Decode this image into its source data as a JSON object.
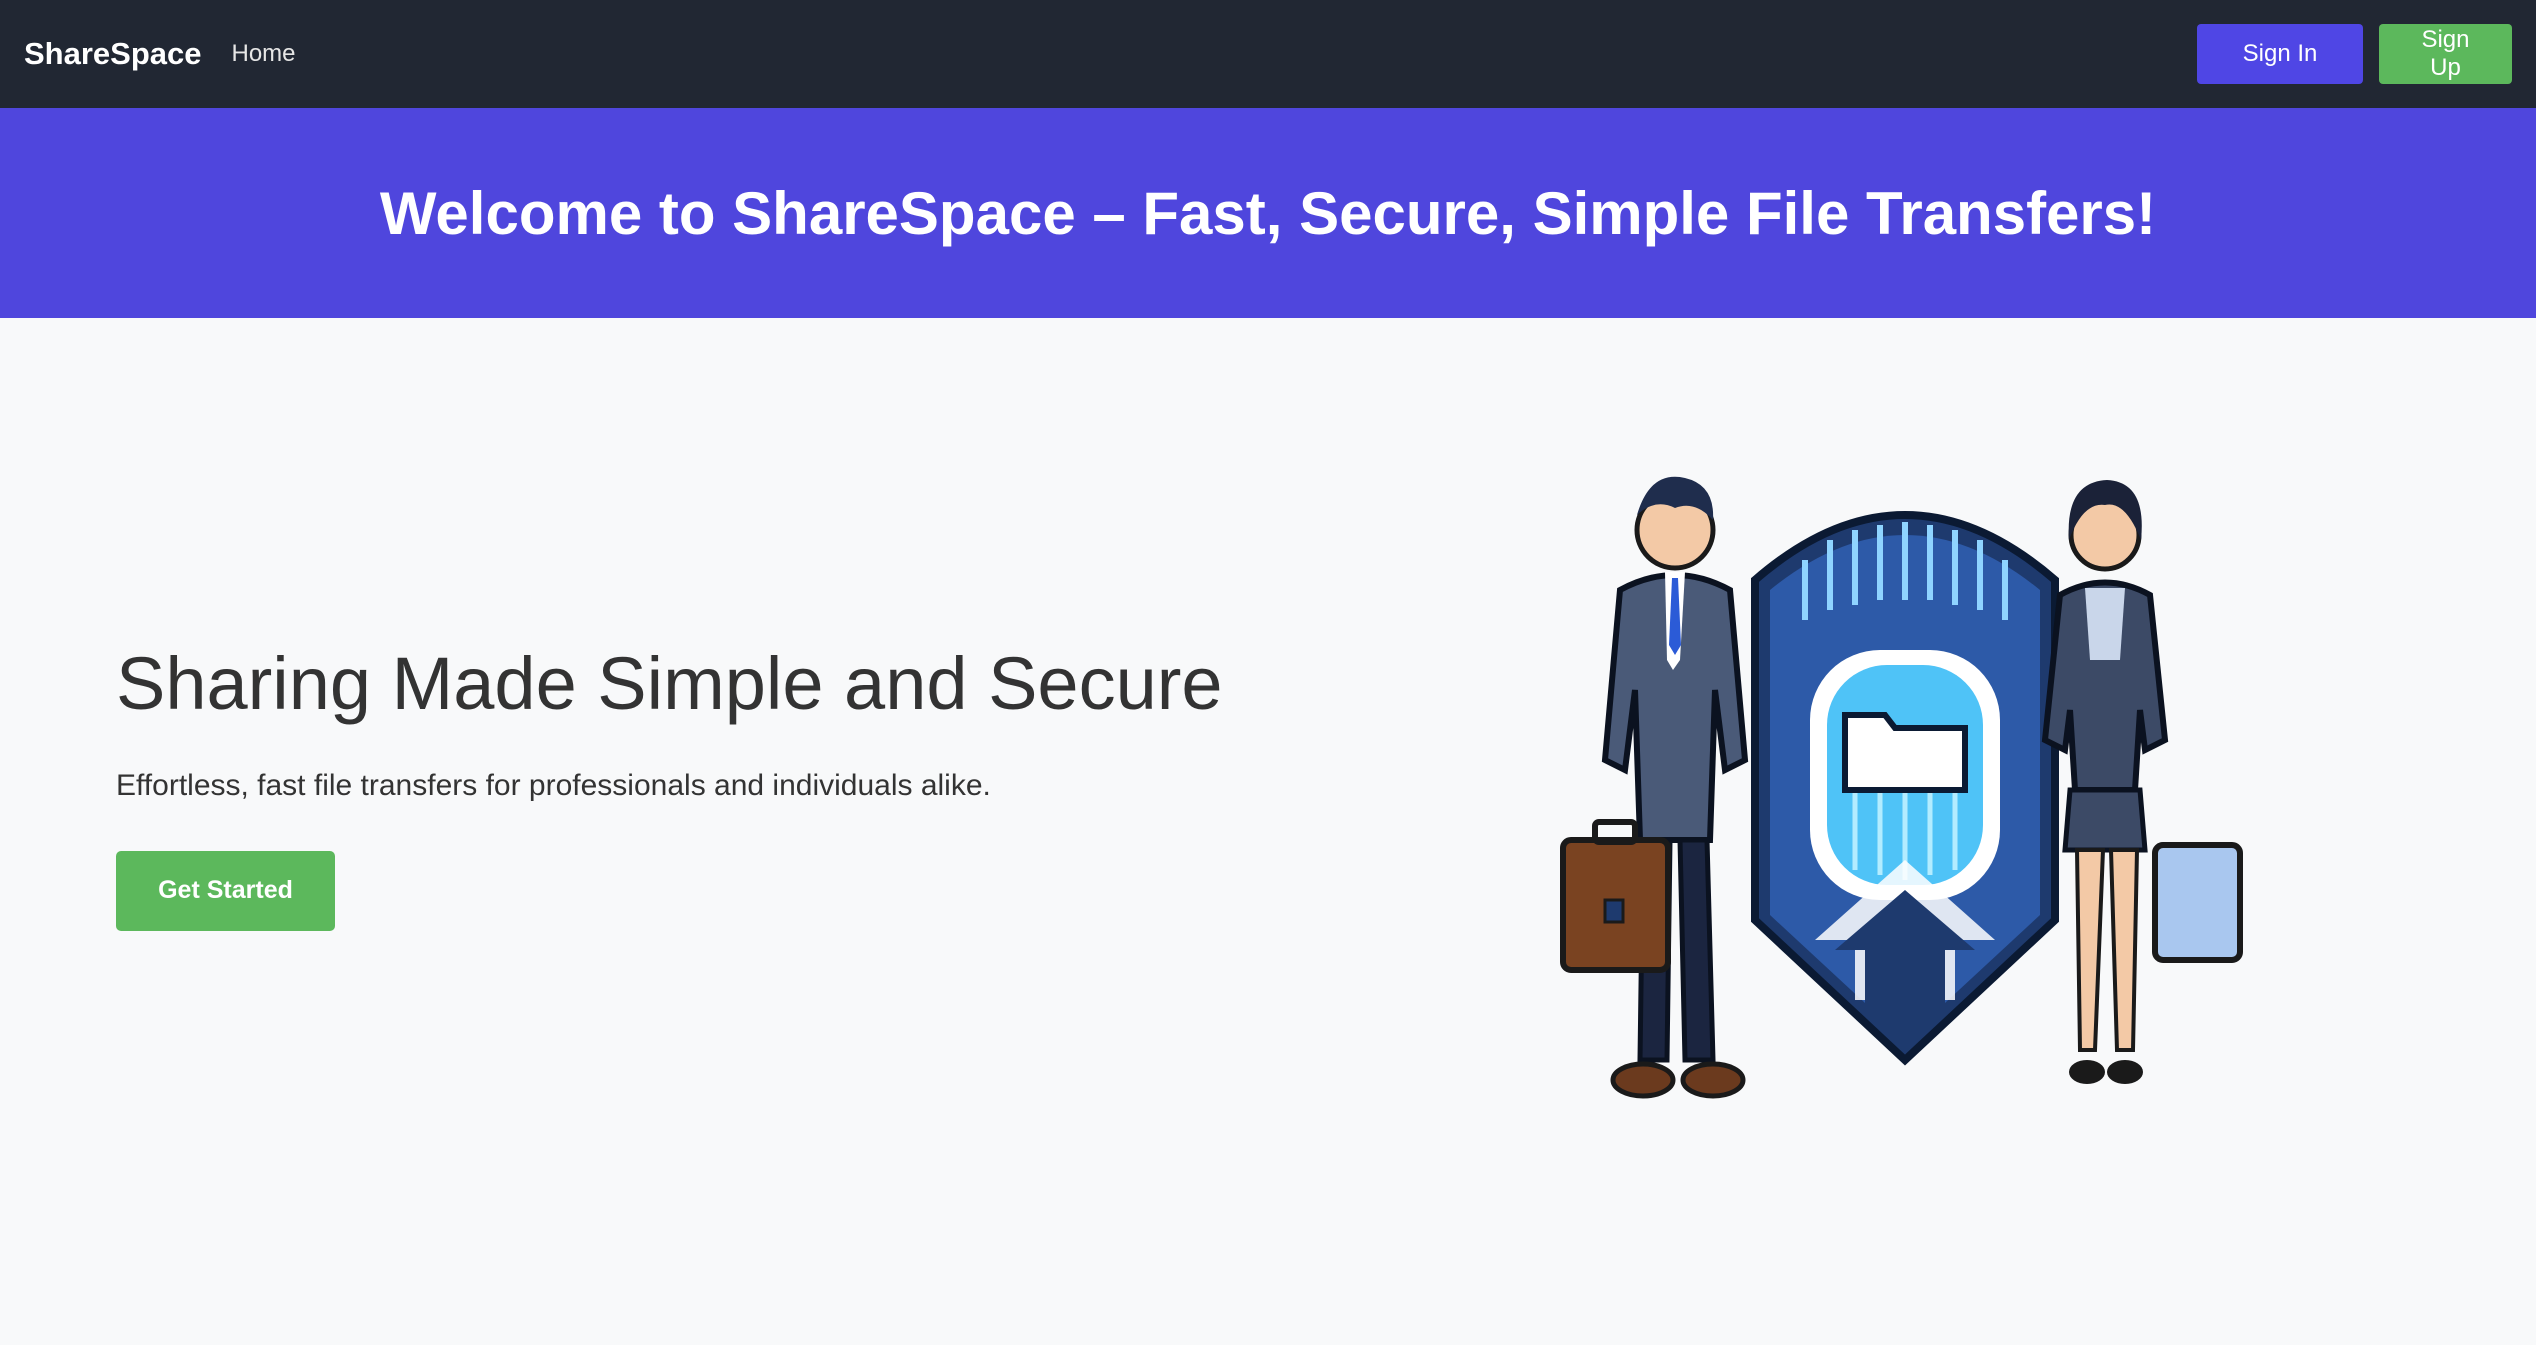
{
  "nav": {
    "brand": "ShareSpace",
    "home": "Home",
    "sign_in": "Sign In",
    "sign_up": "Sign Up"
  },
  "banner": {
    "title": "Welcome to ShareSpace – Fast, Secure, Simple File Transfers!"
  },
  "hero": {
    "title": "Sharing Made Simple and Secure",
    "subtitle": "Effortless, fast file transfers for professionals and individuals alike.",
    "cta": "Get Started"
  },
  "illustration": {
    "icon": "business-people-file-transfer-illustration"
  },
  "colors": {
    "navbar": "#212733",
    "accent": "#4f46e5",
    "success": "#5cb85c",
    "page_background": "#f8f9fa"
  }
}
